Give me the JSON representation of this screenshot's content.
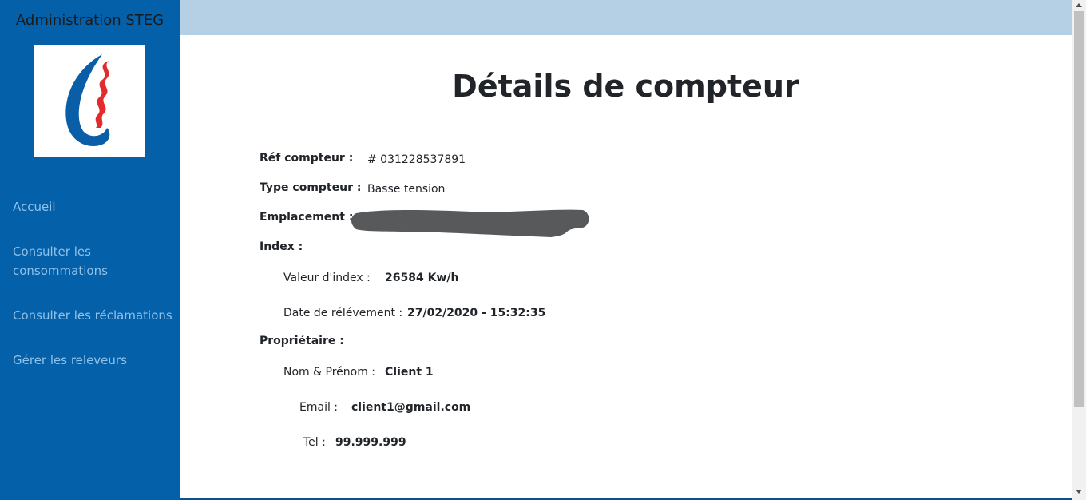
{
  "app": {
    "brand": "Administration STEG"
  },
  "sidebar": {
    "items": [
      {
        "label": "Accueil"
      },
      {
        "label": "Consulter les consommations"
      },
      {
        "label": "Consulter les réclamations"
      },
      {
        "label": "Gérer les releveurs"
      }
    ]
  },
  "colors": {
    "sidebar_bg": "#0460a9",
    "topbar_bg": "#b5cfe4",
    "nav_text": "#8fc1e9",
    "logo_blue": "#0a5ea8",
    "logo_red": "#e32b2b"
  },
  "icons": {
    "logo": "steg-logo-icon"
  },
  "main": {
    "title": "Détails de compteur",
    "fields": {
      "ref_label": "Réf compteur :",
      "ref_value": "# 031228537891",
      "type_label": "Type compteur :",
      "type_value": "Basse tension",
      "emplacement_label": "Emplacement :",
      "index_label": "Index :",
      "index_value_label": "Valeur d'index :",
      "index_value": "26584 Kw/h",
      "date_label": "Date de rélévement :",
      "date_value": "27/02/2020 - 15:32:35",
      "owner_label": "Propriétaire :",
      "name_label": "Nom & Prénom :",
      "name_value": "Client 1",
      "email_label": "Email :",
      "email_value": "client1@gmail.com",
      "tel_label": "Tel :",
      "tel_value": "99.999.999"
    }
  }
}
